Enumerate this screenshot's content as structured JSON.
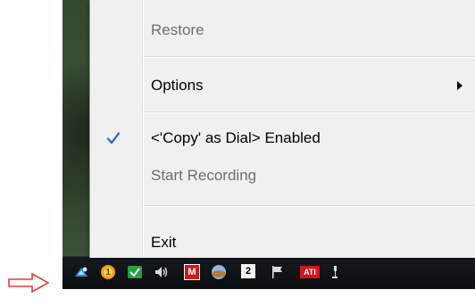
{
  "menu": {
    "restore_label": "Restore",
    "options_label": "Options",
    "copy_as_dial_label": "<'Copy' as Dial> Enabled",
    "start_recording_label": "Start Recording",
    "exit_label": "Exit"
  },
  "tray": {
    "badge_number": "2",
    "ati_label": "ATI",
    "m_label": "M",
    "orange_badge": "1"
  },
  "colors": {
    "checkmark": "#2c63c8",
    "pointer_arrow": "#e23b3b"
  }
}
